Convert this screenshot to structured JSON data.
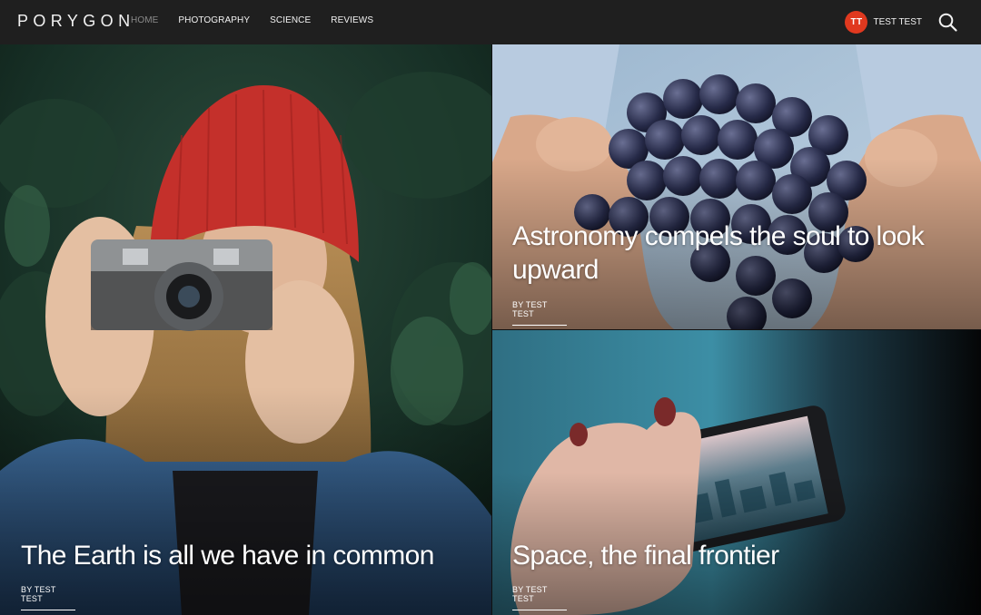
{
  "brand": {
    "logo_text": "PORYGON"
  },
  "nav": {
    "items": [
      {
        "label": "HOME",
        "active": true
      },
      {
        "label": "PHOTOGRAPHY"
      },
      {
        "label": "SCIENCE"
      },
      {
        "label": "REVIEWS"
      }
    ]
  },
  "user": {
    "initials": "TT",
    "name": "TEST TEST",
    "avatar_color": "#e0391f"
  },
  "search": {
    "icon": "search-icon"
  },
  "articles": [
    {
      "title": "The Earth is all we have in common",
      "byline": "BY TEST TEST",
      "image": "woman-with-camera-photo"
    },
    {
      "title": "Astronomy compels the soul to look upward",
      "byline": "BY TEST TEST",
      "image": "hands-holding-grapes-photo"
    },
    {
      "title": "Space, the final frontier",
      "byline": "BY TEST TEST",
      "image": "hand-holding-phone-photo"
    }
  ]
}
